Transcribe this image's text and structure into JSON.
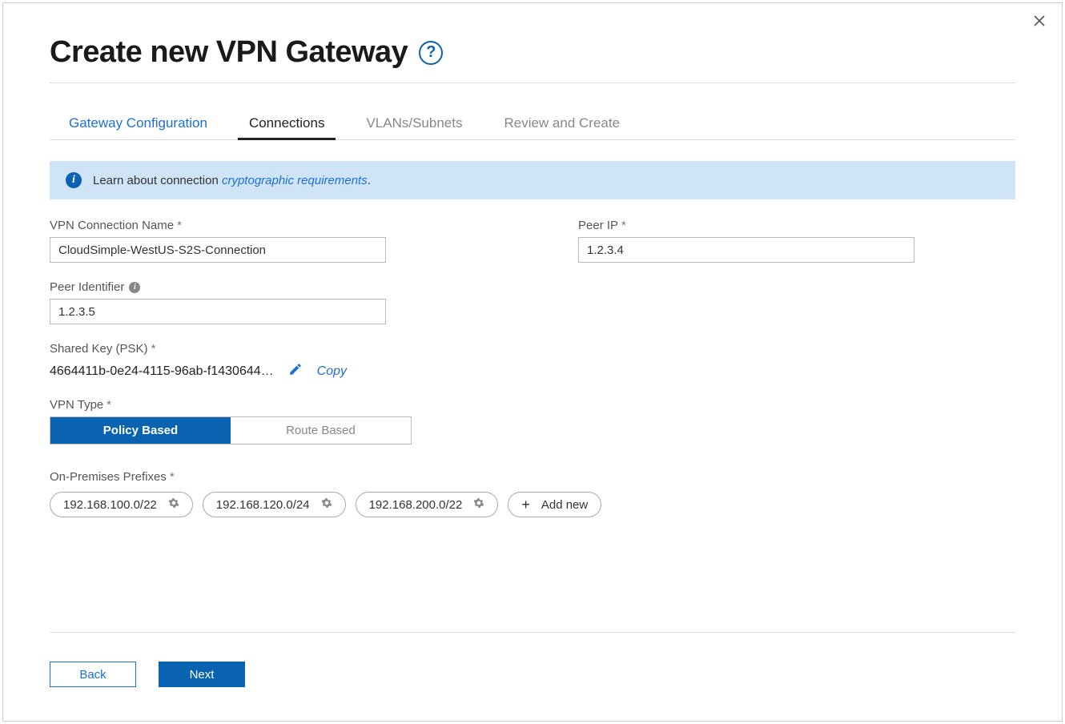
{
  "title": "Create new VPN Gateway",
  "tabs": [
    {
      "label": "Gateway Configuration"
    },
    {
      "label": "Connections"
    },
    {
      "label": "VLANs/Subnets"
    },
    {
      "label": "Review and Create"
    }
  ],
  "info_banner": {
    "prefix": "Learn about connection ",
    "link": "cryptographic requirements",
    "suffix": "."
  },
  "fields": {
    "connection_name": {
      "label": "VPN Connection Name",
      "value": "CloudSimple-WestUS-S2S-Connection"
    },
    "peer_ip": {
      "label": "Peer IP",
      "value": "1.2.3.4"
    },
    "peer_identifier": {
      "label": "Peer Identifier",
      "value": "1.2.3.5"
    },
    "shared_key": {
      "label": "Shared Key  (PSK)",
      "value": "4664411b-0e24-4115-96ab-f1430644…"
    },
    "vpn_type": {
      "label": "VPN Type",
      "options": [
        "Policy Based",
        "Route Based"
      ],
      "selected": "Policy Based"
    },
    "prefixes": {
      "label": "On-Premises Prefixes",
      "values": [
        "192.168.100.0/22",
        "192.168.120.0/24",
        "192.168.200.0/22"
      ],
      "add_label": "Add new"
    }
  },
  "actions": {
    "copy": "Copy",
    "back": "Back",
    "next": "Next"
  }
}
